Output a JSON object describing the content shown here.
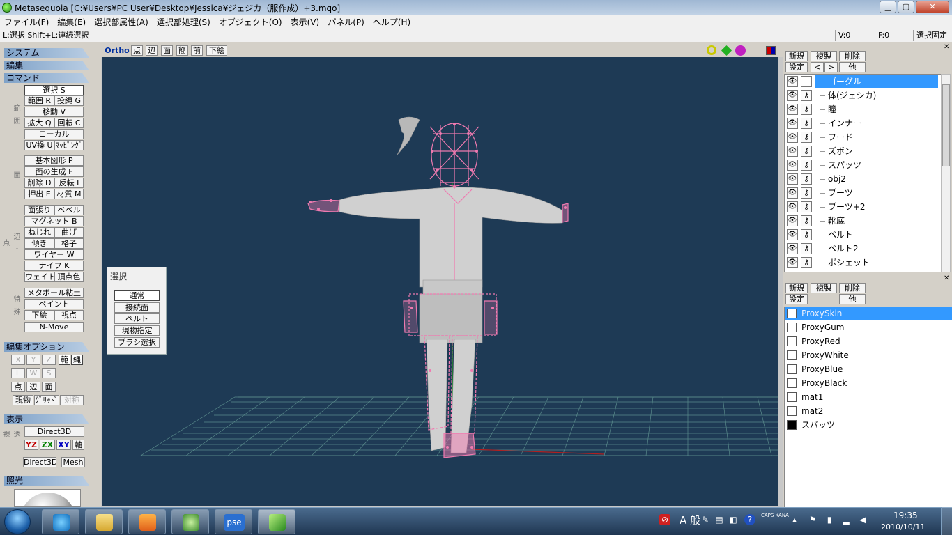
{
  "window": {
    "title": "Metasequoia [C:¥Users¥PC User¥Desktop¥Jessica¥ジェジカ（服作成）+3.mqo]",
    "minimize_icon": "minimize-icon",
    "maximize_icon": "maximize-icon",
    "close_icon": "close-icon"
  },
  "menu": [
    "ファイル(F)",
    "編集(E)",
    "選択部属性(A)",
    "選択部処理(S)",
    "オブジェクト(O)",
    "表示(V)",
    "パネル(P)",
    "ヘルプ(H)"
  ],
  "status": {
    "hint": "L:選択  Shift+L:連続選択",
    "v": "V:0",
    "f": "F:0",
    "lock": "選択固定"
  },
  "left": {
    "sections": {
      "system": "システム",
      "edit": "編集",
      "command": "コマンド",
      "edit_option": "編集オプション",
      "display": "表示",
      "lighting": "照光"
    },
    "vlabels": {
      "range": "範囲",
      "face": "面",
      "edge": "辺・点",
      "special": "特殊",
      "proj": "透視"
    },
    "commands": {
      "select": "選択 S",
      "range": "範囲 R",
      "lasso": "投縄 G",
      "move": "移動 V",
      "scale": "拡大 Q",
      "rotate": "回転 C",
      "local": "ローカル",
      "uv": "UV操 U",
      "mapping": "ﾏｯﾋﾟﾝｸﾞ",
      "primitive": "基本図形 P",
      "make_face": "面の生成 F",
      "delete": "削除 D",
      "flip": "反転 I",
      "extrude": "押出 E",
      "material": "材質 M",
      "face_split": "面張り",
      "bevel": "ベベル",
      "magnet": "マグネット B",
      "twist": "ねじれ",
      "bend": "曲げ",
      "tilt": "傾き",
      "lattice": "格子",
      "wire": "ワイヤー W",
      "knife": "ナイフ K",
      "weight": "ウェイト",
      "vertex_color": "頂点色",
      "metaball": "メタボール粘土",
      "paint": "ペイント",
      "underlay": "下絵",
      "viewpoint": "視点",
      "nmove": "N-Move"
    },
    "options": {
      "x": "X",
      "y": "Y",
      "z": "Z",
      "range": "範",
      "lasso": "縄",
      "l": "L",
      "w": "W",
      "s": "S",
      "point": "点",
      "edge": "辺",
      "face": "面",
      "current": "現物",
      "grid": "ｸﾞﾘｯﾄﾞ",
      "sym": "対称"
    },
    "display": {
      "d3d": "Direct3D",
      "yz": "YZ",
      "zx": "ZX",
      "xy": "XY",
      "axis": "軸",
      "d3d2": "Direct3D",
      "mesh": "Mesh"
    }
  },
  "view_toolbar": {
    "ortho": "Ortho",
    "point": "点",
    "edge": "辺",
    "face": "面",
    "simple": "簡",
    "front": "前",
    "underlay": "下絵",
    "zoom_icon": "zoom-icon",
    "pan_icon": "move-icon",
    "rotate_icon": "rotate-icon",
    "quad_icon": "quad-view-icon"
  },
  "select_dialog": {
    "title": "選択",
    "buttons": [
      "通常",
      "接続面",
      "ベルト",
      "現物指定",
      "ブラシ選択"
    ]
  },
  "objects": {
    "buttons": {
      "new": "新規",
      "copy": "複製",
      "delete": "削除",
      "settings": "設定",
      "prev": "<",
      "next": ">",
      "other": "他"
    },
    "items": [
      {
        "name": "ゴーグル",
        "selected": true
      },
      {
        "name": "体(ジェシカ)"
      },
      {
        "name": "瞳"
      },
      {
        "name": "インナー"
      },
      {
        "name": "フード"
      },
      {
        "name": "ズボン"
      },
      {
        "name": "スパッツ"
      },
      {
        "name": "obj2"
      },
      {
        "name": "ブーツ"
      },
      {
        "name": "ブーツ+2"
      },
      {
        "name": "靴底"
      },
      {
        "name": "ベルト"
      },
      {
        "name": "ベルト2"
      },
      {
        "name": "ポシェット"
      }
    ]
  },
  "materials": {
    "buttons": {
      "new": "新規",
      "copy": "複製",
      "delete": "削除",
      "settings": "設定",
      "other": "他"
    },
    "items": [
      {
        "name": "ProxySkin",
        "color": "#ffffff",
        "selected": true
      },
      {
        "name": "ProxyGum",
        "color": "#ffffff"
      },
      {
        "name": "ProxyRed",
        "color": "#ffffff"
      },
      {
        "name": "ProxyWhite",
        "color": "#ffffff"
      },
      {
        "name": "ProxyBlue",
        "color": "#ffffff"
      },
      {
        "name": "ProxyBlack",
        "color": "#ffffff"
      },
      {
        "name": "mat1",
        "color": "#ffffff"
      },
      {
        "name": "mat2",
        "color": "#ffffff"
      },
      {
        "name": "スパッツ",
        "color": "#000000"
      }
    ]
  },
  "taskbar": {
    "apps": [
      "start-orb-icon",
      "ie-icon",
      "explorer-icon",
      "media-icon",
      "tool-icon",
      "pse-icon",
      "metasequoia-icon"
    ],
    "pse_label": "pse",
    "ime": "A 般",
    "caps": "CAPS\nKANA",
    "time": "19:35",
    "date": "2010/10/11"
  },
  "colors": {
    "viewport_bg": "#1e3a55",
    "wire": "#f07ab0",
    "grid": "#5a8c8c",
    "accent": "#3399ff"
  }
}
